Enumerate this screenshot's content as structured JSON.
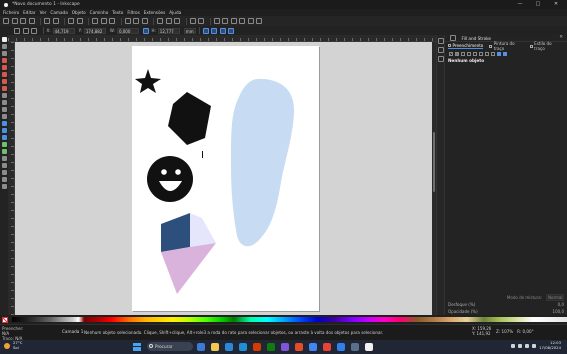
{
  "window": {
    "title": "*Novo documento 1 - Inkscape",
    "controls": [
      "—",
      "□",
      "✕"
    ]
  },
  "menu": [
    "Ficheiro",
    "Editar",
    "Ver",
    "Camada",
    "Objeto",
    "Caminho",
    "Texto",
    "Filtros",
    "Extensões",
    "Ajuda"
  ],
  "toolcontrols": {
    "x_label": "X:",
    "x_value": "44,719",
    "y_label": "Y:",
    "y_value": "174,882",
    "w_label": "W:",
    "w_value": "0,000",
    "h_label": "H:",
    "h_value": "12,777",
    "units": "mm"
  },
  "canvas": {
    "page_color": "#ffffff",
    "desk_color": "#d3d3d3",
    "shapes": [
      {
        "name": "star",
        "color": "#111111"
      },
      {
        "name": "pentagon",
        "color": "#111111"
      },
      {
        "name": "smiley-face",
        "color": "#111111"
      },
      {
        "name": "freehand-blob",
        "color": "#c7dcf3"
      },
      {
        "name": "3d-box",
        "colors": [
          "#2d4f7c",
          "#e5e6fb",
          "#dab3dd"
        ]
      }
    ]
  },
  "panel": {
    "title": "Fill and Stroke",
    "tabs": [
      "Preenchimento",
      "Pintura do traço",
      "Estilo do traço"
    ],
    "no_object": "Nenhum objeto",
    "blend_label": "Modo de mistura:",
    "blend_value": "Normal",
    "blur_label": "Desfoque (%)",
    "blur_value": "0,0",
    "opacity_label": "Opacidade (%)",
    "opacity_value": "100,0"
  },
  "status": {
    "fill_label": "Preencher:",
    "fill_value": "N/A",
    "stroke_label": "Traço:",
    "stroke_value": "N/A",
    "layer_label": "Camada 1",
    "message": "Nenhum objeto selecionado. Clique, Shift+clique, Alt+role3 a roda do rato para selecionar objetos, ou arraste à volta dos objetos para selecionar.",
    "x_coord": "X: 159,26",
    "y_coord": "Y: 141,92",
    "zoom": "Z: 107%",
    "rotation": "R: 0,00°"
  },
  "taskbar": {
    "weather_temp": "27°C",
    "weather_desc": "Sol",
    "search_placeholder": "Procurar",
    "time": "12:03",
    "date": "17/08/2024"
  }
}
